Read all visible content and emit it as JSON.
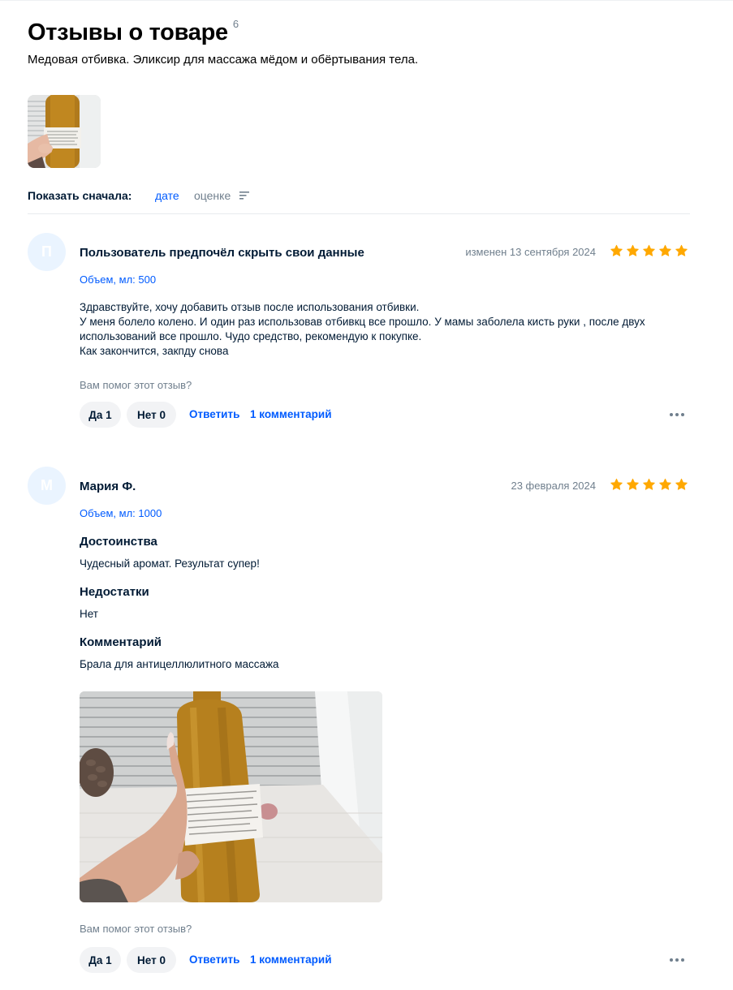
{
  "page": {
    "title": "Отзывы о товаре",
    "review_count": "6",
    "product_name": "Медовая отбивка. Эликсир для массажа мёдом и обёртывания тела."
  },
  "sort": {
    "label": "Показать сначала:",
    "options": [
      "дате",
      "оценке"
    ],
    "active": "дате"
  },
  "colors": {
    "accent": "#005bff",
    "star": "#ffa800",
    "muted": "#707f8d",
    "pill_bg": "#f2f3f5",
    "avatar_bg": "#eaf4ff"
  },
  "reviews": [
    {
      "avatar_letter": "П",
      "author": "Пользователь предпочёл скрыть свои данные",
      "date": "изменен 13 сентября 2024",
      "rating": 5,
      "variant": "Объем, мл: 500",
      "text_lines": [
        "Здравствуйте, хочу добавить отзыв после использования отбивки.",
        "У меня болело колено. И один раз использовав отбивкц все прошло. У мамы заболела кисть руки , после двух",
        "использований все прошло. Чудо средство, рекомендую к покупке.",
        "Как закончится, закпду снова"
      ],
      "helpful_question": "Вам помог этот отзыв?",
      "yes_label": "Да 1",
      "no_label": "Нет 0",
      "reply_label": "Ответить",
      "comments_label": "1 комментарий"
    },
    {
      "avatar_letter": "М",
      "author": "Мария Ф.",
      "date": "23 февраля 2024",
      "rating": 5,
      "variant": "Объем, мл: 1000",
      "pros_heading": "Достоинства",
      "pros": "Чудесный аромат. Результат супер!",
      "cons_heading": "Недостатки",
      "cons": "Нет",
      "comment_heading": "Комментарий",
      "comment": "Брала для антицеллюлитного массажа",
      "helpful_question": "Вам помог этот отзыв?",
      "yes_label": "Да 1",
      "no_label": "Нет 0",
      "reply_label": "Ответить",
      "comments_label": "1 комментарий"
    }
  ],
  "icons": {
    "sort": "sort-lines-icon",
    "star": "star-icon",
    "more": "more-dots-icon"
  }
}
